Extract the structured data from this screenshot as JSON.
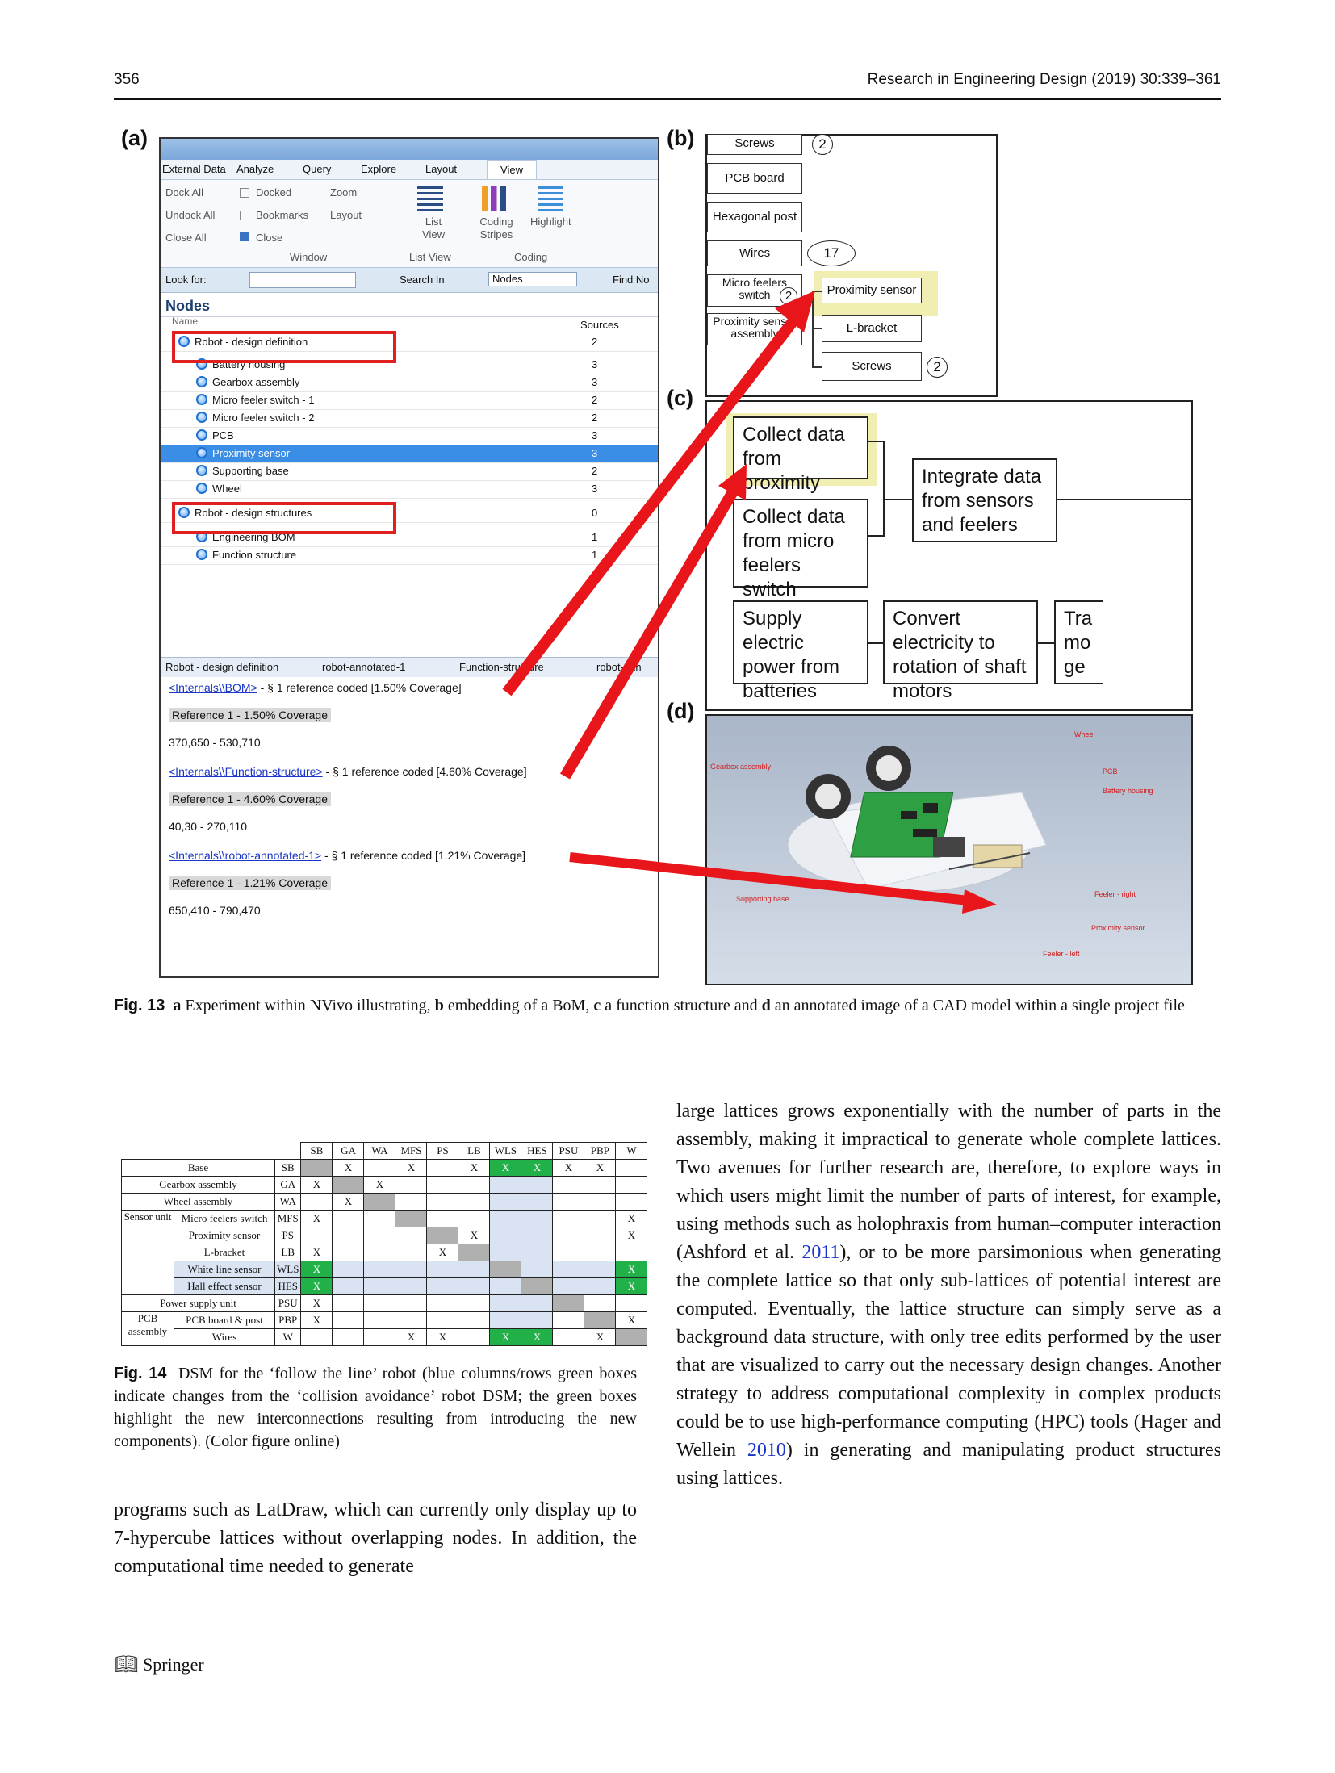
{
  "header": {
    "page_number": "356",
    "journal": "Research in Engineering Design (2019) 30:339–361"
  },
  "panel_labels": {
    "a": "(a)",
    "b": "(b)",
    "c": "(c)",
    "d": "(d)"
  },
  "nvivo": {
    "tabs": [
      "External Data",
      "Analyze",
      "Query",
      "Explore",
      "Layout",
      "View"
    ],
    "ribbon": {
      "window_items": [
        "Dock All",
        "Undock All",
        "Close All"
      ],
      "docked": "Docked",
      "bookmarks": "Bookmarks",
      "close": "Close",
      "zoom": "Zoom",
      "layout": "Layout",
      "list_view": "List View",
      "coding_stripes": "Coding Stripes",
      "highlight": "Highlight",
      "group_window": "Window",
      "group_list_view": "List View",
      "group_coding": "Coding"
    },
    "look_for": "Look for:",
    "search_in": "Search In",
    "search_scope": "Nodes",
    "find_now": "Find No",
    "nodes_title": "Nodes",
    "col_name": "Name",
    "col_sources": "Sources",
    "tree": [
      {
        "name": "Robot - design definition",
        "sources": "2",
        "level": 0,
        "selected": false
      },
      {
        "name": "Battery housing",
        "sources": "3",
        "level": 1,
        "selected": false
      },
      {
        "name": "Gearbox assembly",
        "sources": "3",
        "level": 1,
        "selected": false
      },
      {
        "name": "Micro feeler switch - 1",
        "sources": "2",
        "level": 1,
        "selected": false
      },
      {
        "name": "Micro feeler switch - 2",
        "sources": "2",
        "level": 1,
        "selected": false
      },
      {
        "name": "PCB",
        "sources": "3",
        "level": 1,
        "selected": false
      },
      {
        "name": "Proximity sensor",
        "sources": "3",
        "level": 1,
        "selected": true
      },
      {
        "name": "Supporting base",
        "sources": "2",
        "level": 1,
        "selected": false
      },
      {
        "name": "Wheel",
        "sources": "3",
        "level": 1,
        "selected": false
      },
      {
        "name": "Robot - design structures",
        "sources": "0",
        "level": 0,
        "selected": false
      },
      {
        "name": "Engineering BOM",
        "sources": "1",
        "level": 1,
        "selected": false
      },
      {
        "name": "Function structure",
        "sources": "1",
        "level": 1,
        "selected": false
      }
    ],
    "doc_tabs": [
      "Robot - design definition",
      "robot-annotated-1",
      "Function-structure",
      "robot-ann"
    ],
    "coverage": [
      {
        "link": "<Internals\\\\BOM>",
        "summary": " - § 1 reference coded  [1.50% Coverage]",
        "ref": "Reference 1 - 1.50% Coverage",
        "range": "370,650 - 530,710"
      },
      {
        "link": "<Internals\\\\Function-structure>",
        "summary": " - § 1 reference coded  [4.60% Coverage]",
        "ref": "Reference 1 - 4.60% Coverage",
        "range": "40,30 - 270,110"
      },
      {
        "link": "<Internals\\\\robot-annotated-1>",
        "summary": " - § 1 reference coded  [1.21% Coverage]",
        "ref": "Reference 1 - 1.21% Coverage",
        "range": "650,410 - 790,470"
      }
    ]
  },
  "bom": {
    "items": [
      "Screws",
      "PCB board",
      "Hexagonal post",
      "Wires",
      "Micro feelers switch",
      "Proximity sensor assembly",
      "Proximity sensor",
      "L-bracket",
      "Screws"
    ],
    "counts": [
      "2",
      "17",
      "2",
      "2"
    ]
  },
  "function_structure": {
    "boxes": [
      "Collect data from proximity sensors",
      "Collect data from micro feelers switch",
      "Integrate data from sensors and feelers",
      "Supply electric power from batteries",
      "Convert electricity to rotation of shaft motors",
      "Tra mo ge"
    ]
  },
  "cad_labels": [
    "Wheel",
    "Gearbox assembly",
    "PCB",
    "Battery housing",
    "Supporting base",
    "Feeler - right",
    "Proximity sensor",
    "Feeler - left"
  ],
  "fig13_caption": {
    "label": "Fig. 13",
    "parts": [
      {
        "bold": "a",
        "text": " Experiment within NVivo illustrating, "
      },
      {
        "bold": "b",
        "text": " embedding of a BoM, "
      },
      {
        "bold": "c",
        "text": " a function structure and "
      },
      {
        "bold": "d",
        "text": " an annotated image of a CAD model within a single project file"
      }
    ]
  },
  "dsm": {
    "columns": [
      "SB",
      "GA",
      "WA",
      "MFS",
      "PS",
      "LB",
      "WLS",
      "HES",
      "PSU",
      "PBP",
      "W"
    ],
    "rows": [
      {
        "group": "",
        "name": "Base",
        "code": "SB",
        "cells": [
          "g",
          "X",
          "",
          "X",
          "",
          "X",
          "X*",
          "X*",
          "X",
          "X",
          ""
        ]
      },
      {
        "group": "",
        "name": "Gearbox assembly",
        "code": "GA",
        "cells": [
          "X",
          "g",
          "X",
          "",
          "",
          "",
          "b",
          "b",
          "",
          "",
          ""
        ]
      },
      {
        "group": "",
        "name": "Wheel assembly",
        "code": "WA",
        "cells": [
          "",
          "X",
          "g",
          "",
          "",
          "",
          "b",
          "b",
          "",
          "",
          ""
        ]
      },
      {
        "group": "Sensor unit",
        "name": "Micro feelers switch",
        "code": "MFS",
        "cells": [
          "X",
          "",
          "",
          "g",
          "",
          "",
          "b",
          "b",
          "",
          "",
          "X"
        ]
      },
      {
        "group": "",
        "name": "Proximity sensor",
        "code": "PS",
        "cells": [
          "",
          "",
          "",
          "",
          "g",
          "X",
          "b",
          "b",
          "",
          "",
          "X"
        ]
      },
      {
        "group": "",
        "name": "L-bracket",
        "code": "LB",
        "cells": [
          "X",
          "",
          "",
          "",
          "X",
          "g",
          "b",
          "b",
          "",
          "",
          ""
        ]
      },
      {
        "group": "",
        "name": "White line sensor",
        "code": "WLS",
        "cells": [
          "X*",
          "b",
          "b",
          "b",
          "b",
          "b",
          "g",
          "b",
          "b",
          "b",
          "X*"
        ]
      },
      {
        "group": "",
        "name": "Hall effect sensor",
        "code": "HES",
        "cells": [
          "X*",
          "b",
          "b",
          "b",
          "b",
          "b",
          "b",
          "g",
          "b",
          "b",
          "X*"
        ]
      },
      {
        "group": "",
        "name": "Power supply unit",
        "code": "PSU",
        "cells": [
          "X",
          "",
          "",
          "",
          "",
          "",
          "b",
          "b",
          "g",
          "",
          ""
        ]
      },
      {
        "group": "PCB assembly",
        "name": "PCB board & post",
        "code": "PBP",
        "cells": [
          "X",
          "",
          "",
          "",
          "",
          "",
          "b",
          "b",
          "",
          "g",
          "X"
        ]
      },
      {
        "group": "",
        "name": "Wires",
        "code": "W",
        "cells": [
          "",
          "",
          "",
          "X",
          "X",
          "",
          "X*",
          "X*",
          "",
          "X",
          "g"
        ]
      }
    ],
    "group_labels": [
      "Sensor unit",
      "PCB assembly"
    ]
  },
  "fig14_caption": {
    "label": "Fig. 14",
    "text": "DSM for the ‘follow the line’ robot (blue columns/rows green boxes indicate changes from the ‘collision avoidance’ robot DSM; the green boxes highlight the new interconnections resulting from introducing the new components). (Color figure online)"
  },
  "body_left": "programs such as LatDraw, which can currently only display up to 7-hypercube lattices without overlapping nodes. In addition, the computational time needed to generate",
  "body_right": {
    "p1": "large lattices grows exponentially with the number of parts in the assembly, making it impractical to generate whole complete lattices. Two avenues for further research are, therefore, to explore ways in which users might limit the number of parts of interest, for example, using methods such as holophraxis from human–computer interaction (Ashford et al. ",
    "cite1": "2011",
    "p2": "), or to be more parsimonious when generating the complete lattice so that only sub-lattices of potential interest are computed. Eventually, the lattice structure can simply serve as a background data structure, with only tree edits performed by the user that are visualized to carry out the necessary design changes. Another strategy to address computational complexity in complex products could be to use high-performance computing (HPC) tools (Hager and Wellein ",
    "cite2": "2010",
    "p3": ") in generating and manipulating product structures using lattices."
  },
  "footer": {
    "publisher": "Springer"
  },
  "colors": {
    "red_arrow": "#e8161b",
    "highlight_yellow": "#f1eeb1",
    "dsm_green": "#22b048",
    "dsm_blue": "#d9e3f2",
    "dsm_grey": "#b0b0b0",
    "link_blue": "#1a35c8"
  }
}
